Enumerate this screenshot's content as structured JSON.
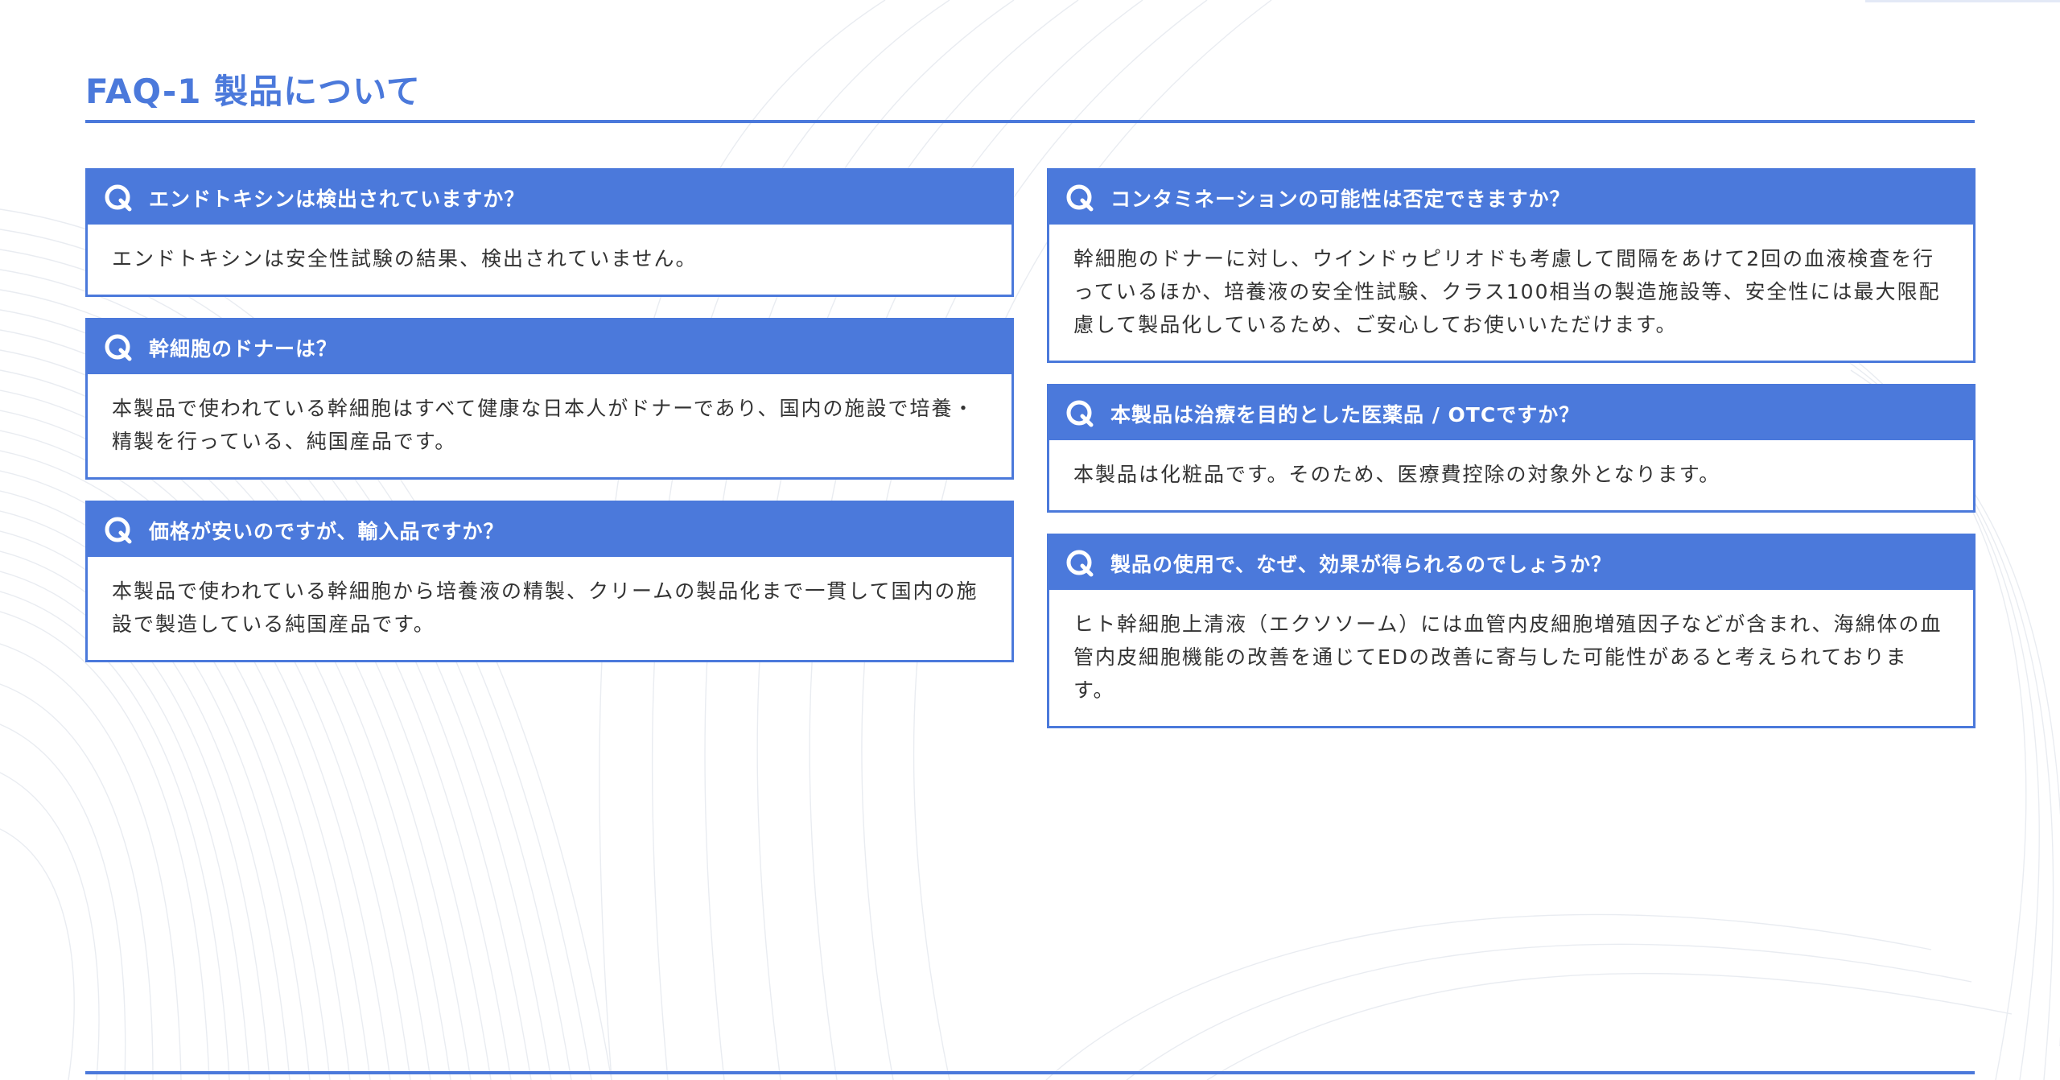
{
  "header": {
    "title": "FAQ-1 製品について"
  },
  "faq_left": [
    {
      "question": "エンドトキシンは検出されていますか？",
      "answer": "エンドトキシンは安全性試験の結果、検出されていません。"
    },
    {
      "question": "幹細胞のドナーは？",
      "answer": "本製品で使われている幹細胞はすべて健康な日本人がドナーであり、国内の施設で培養・精製を行っている、純国産品です。"
    },
    {
      "question": "価格が安いのですが、輸入品ですか？",
      "answer": "本製品で使われている幹細胞から培養液の精製、クリームの製品化まで一貫して国内の施設で製造している純国産品です。"
    }
  ],
  "faq_right": [
    {
      "question": "コンタミネーションの可能性は否定できますか？",
      "answer": "幹細胞のドナーに対し、ウインドゥピリオドも考慮して間隔をあけて2回の血液検査を行っているほか、培養液の安全性試験、クラス100相当の製造施設等、安全性には最大限配慮して製品化しているため、ご安心してお使いいただけます。"
    },
    {
      "question": "本製品は治療を目的とした医薬品 / OTCですか？",
      "answer": "本製品は化粧品です。そのため、医療費控除の対象外となります。"
    },
    {
      "question": "製品の使用で、なぜ、効果が得られるのでしょうか？",
      "answer": "ヒト幹細胞上清液（エクソソーム）には血管内皮細胞増殖因子などが含まれ、海綿体の血管内皮細胞機能の改善を通じてEDの改善に寄与した可能性があると考えられております。"
    }
  ],
  "icons": {
    "question_icon": "q-letter-icon"
  },
  "colors": {
    "accent": "#4b79db",
    "text": "#333333",
    "background": "#ffffff"
  }
}
